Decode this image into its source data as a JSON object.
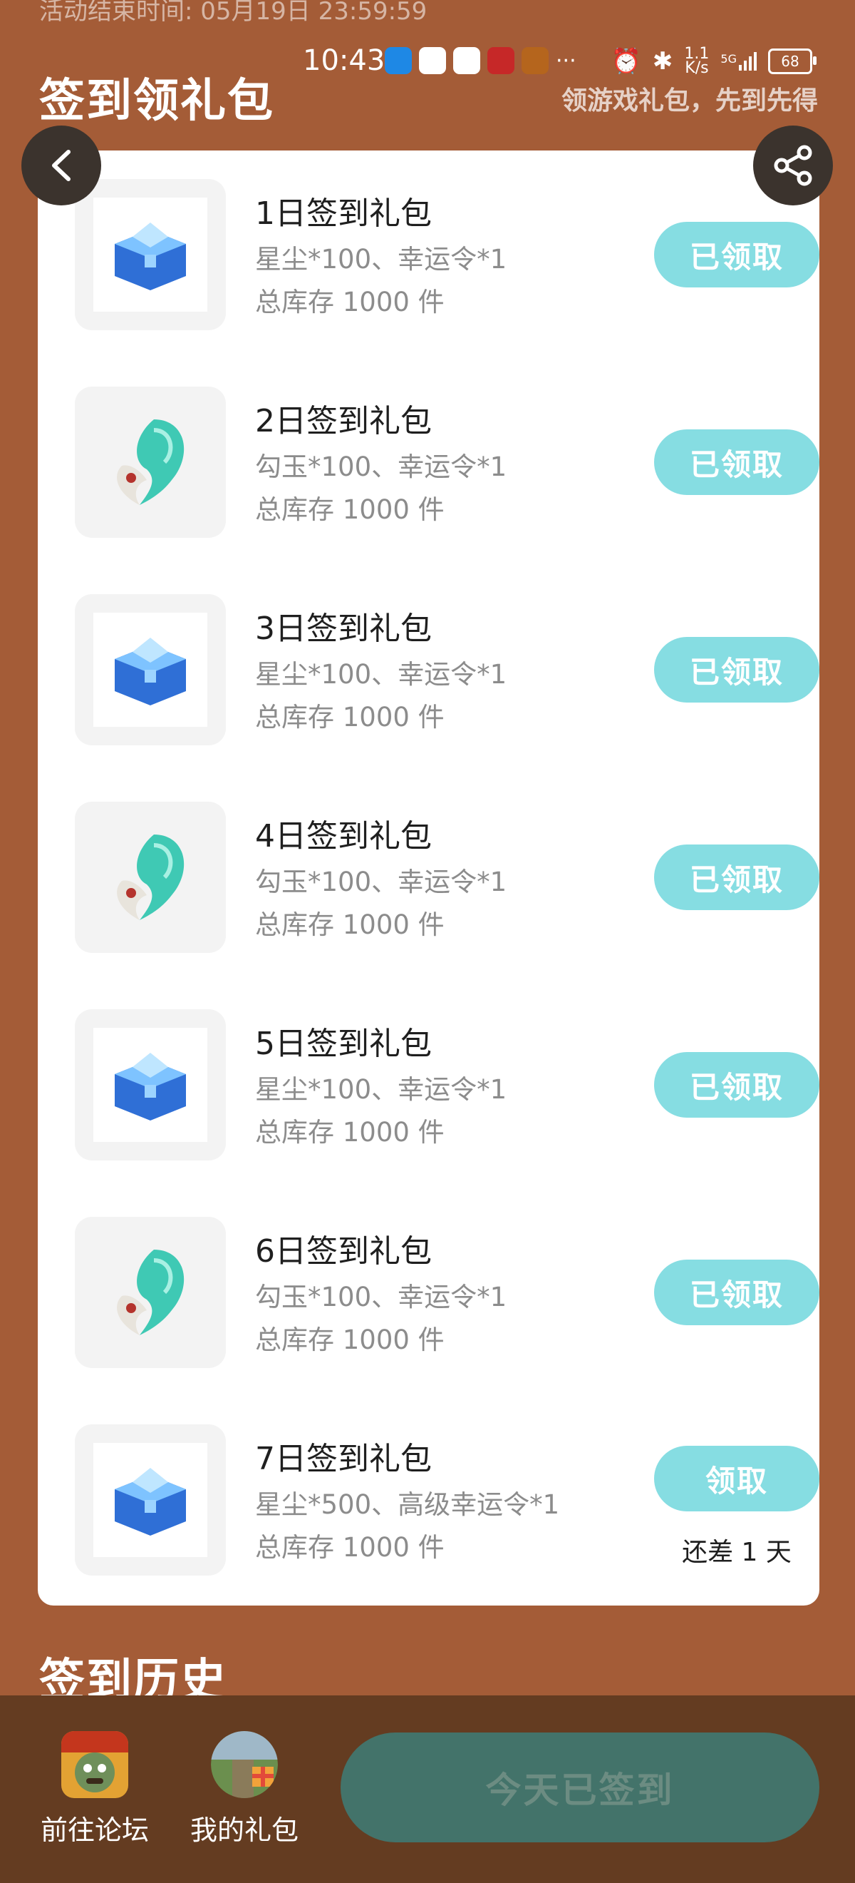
{
  "activity": {
    "end_time_text": "活动结束时间: 05月19日 23:59:59"
  },
  "status_bar": {
    "time": "10:43",
    "net_speed_top": "1.1",
    "net_speed_unit": "K/s",
    "network": "5G",
    "battery": "68"
  },
  "header": {
    "title": "签到领礼包",
    "subtitle": "领游戏礼包，先到先得"
  },
  "gifts": [
    {
      "title": "1日签到礼包",
      "desc": "星尘*100、幸运令*1",
      "stock": "总库存 1000 件",
      "button": "已领取",
      "icon": "chest-icon"
    },
    {
      "title": "2日签到礼包",
      "desc": "勾玉*100、幸运令*1",
      "stock": "总库存 1000 件",
      "button": "已领取",
      "icon": "jade-icon"
    },
    {
      "title": "3日签到礼包",
      "desc": "星尘*100、幸运令*1",
      "stock": "总库存 1000 件",
      "button": "已领取",
      "icon": "chest-icon"
    },
    {
      "title": "4日签到礼包",
      "desc": "勾玉*100、幸运令*1",
      "stock": "总库存 1000 件",
      "button": "已领取",
      "icon": "jade-icon"
    },
    {
      "title": "5日签到礼包",
      "desc": "星尘*100、幸运令*1",
      "stock": "总库存 1000 件",
      "button": "已领取",
      "icon": "chest-icon"
    },
    {
      "title": "6日签到礼包",
      "desc": "勾玉*100、幸运令*1",
      "stock": "总库存 1000 件",
      "button": "已领取",
      "icon": "jade-icon"
    },
    {
      "title": "7日签到礼包",
      "desc": "星尘*500、高级幸运令*1",
      "stock": "总库存 1000 件",
      "button": "领取",
      "remain": "还差 1 天",
      "icon": "chest-icon"
    }
  ],
  "history": {
    "title": "签到历史"
  },
  "bottom": {
    "forum_label": "前往论坛",
    "mygifts_label": "我的礼包",
    "signed_label": "今天已签到"
  },
  "colors": {
    "background": "#a45c37",
    "button_claimed": "#86dde2",
    "bottom_bar": "#643c21",
    "signed_button": "#43736a"
  }
}
